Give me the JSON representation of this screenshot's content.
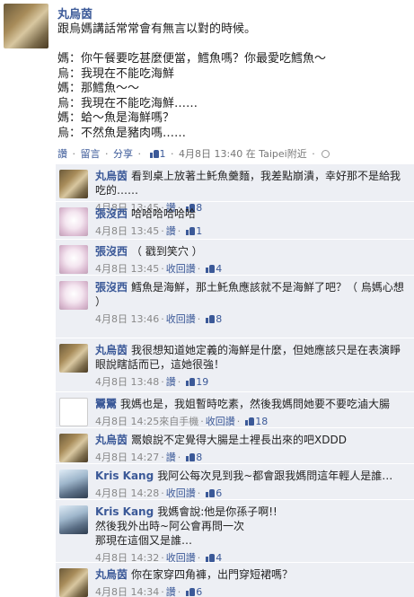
{
  "post": {
    "author": "丸烏茵",
    "lines": [
      "跟烏媽講話常常會有無言以對的時候。",
      "",
      "媽：你午餐要吃甚麼便當，鱈魚嗎？你最愛吃鱈魚～",
      "烏：我現在不能吃海鮮",
      "媽：那鱈魚～～",
      "烏：我現在不能吃海鮮……",
      "媽：蛤～魚是海鮮嗎？",
      "烏：不然魚是豬肉嗎……"
    ],
    "meta": {
      "like": "讚",
      "comment": "留言",
      "share": "分享",
      "likes_count": "1",
      "timestamp": "4月8日 13:40 在 Taipei附近",
      "separator": "·"
    }
  },
  "comments": [
    {
      "author": "丸烏茵",
      "avatar": "av-wan",
      "text": "看到桌上放著土魠魚羹麵，我差點崩潰，幸好那不是給我吃的……",
      "time": "4月8日 13:45",
      "retract": "",
      "like": "讚",
      "likes": "8"
    },
    {
      "author": "張沒西",
      "avatar": "av-zhang",
      "text": "哈哈哈哈哈哈",
      "time": "4月8日 13:45",
      "retract": "",
      "like": "讚",
      "likes": "1"
    },
    {
      "author": "張沒西",
      "avatar": "av-zhang",
      "text": "（ 戳到笑穴 ）",
      "time": "4月8日 13:45",
      "retract": "收回讚",
      "like": "",
      "likes": "4"
    },
    {
      "author": "張沒西",
      "avatar": "av-zhang",
      "text": "鱈魚是海鮮，那土魠魚應該就不是海鮮了吧？（ 烏媽心想 ）",
      "time": "4月8日 13:46",
      "retract": "收回讚",
      "like": "",
      "likes": "8"
    },
    {
      "author": "丸烏茵",
      "avatar": "av-wan",
      "text": "我很想知道她定義的海鮮是什麼，但她應該只是在表演睜眼說瞎話而已，這她很強！",
      "time": "4月8日 13:48",
      "retract": "",
      "like": "讚",
      "likes": "19"
    },
    {
      "author": "鬻鬻",
      "avatar": "av-feng",
      "text": "我媽也是，我姐暫時吃素，然後我媽問她要不要吃滷大腸",
      "time": "4月8日 14:25",
      "via": "來自手機",
      "retract": "收回讚",
      "like": "",
      "likes": "18"
    },
    {
      "author": "丸烏茵",
      "avatar": "av-wan",
      "text": "鬻娘說不定覺得大腸是土裡長出來的吧XDDD",
      "time": "4月8日 14:27",
      "retract": "",
      "like": "讚",
      "likes": "8"
    },
    {
      "author": "Kris Kang",
      "avatar": "av-kris",
      "text": "我阿公每次見到我~都會跟我媽問這年輕人是誰…",
      "time": "4月8日 14:28",
      "retract": "收回讚",
      "like": "",
      "likes": "6"
    },
    {
      "author": "Kris Kang",
      "avatar": "av-kris",
      "text": "我媽會說:他是你孫子啊!!",
      "text2": "然後我外出時~阿公會再問一次",
      "text3": "那現在這個又是誰…",
      "time": "4月8日 14:32",
      "retract": "收回讚",
      "like": "",
      "likes": "4"
    },
    {
      "author": "丸烏茵",
      "avatar": "av-wan",
      "text": "你在家穿四角褲，出門穿短裙嗎？",
      "time": "4月8日 14:34",
      "retract": "",
      "like": "讚",
      "likes": "6"
    }
  ]
}
